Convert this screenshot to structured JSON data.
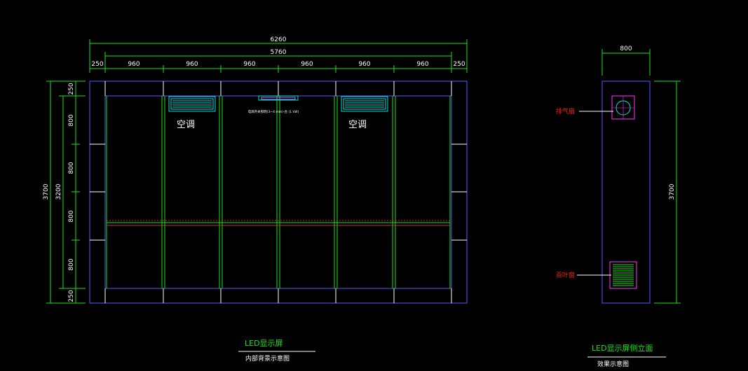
{
  "front": {
    "top_total": "6260",
    "inner_total": "5760",
    "side_width": "250",
    "module_width": "960",
    "left_total": "3700",
    "left_inner": "3200",
    "row_height": "800",
    "edge_height": "250",
    "ac_label": "空调",
    "center_note": "电源开关照明(3~4 mm)-台 (1 kW)",
    "title": "LED显示屏",
    "subtitle": "内部背景示意图"
  },
  "side": {
    "top_width": "800",
    "right_total": "3700",
    "vent_label": "排气扇",
    "louver_label": "百叶窗",
    "title": "LED显示屏侧立面",
    "subtitle": "效果示意图"
  },
  "colors": {
    "background": "#000000",
    "dimension": "#19e619",
    "frame": "#5858ff",
    "grid": "#ffffff",
    "ac_unit": "#00e5e5",
    "fan": "#ff33ff",
    "callout_text": "#ff2020",
    "beam": "#cc3333"
  }
}
